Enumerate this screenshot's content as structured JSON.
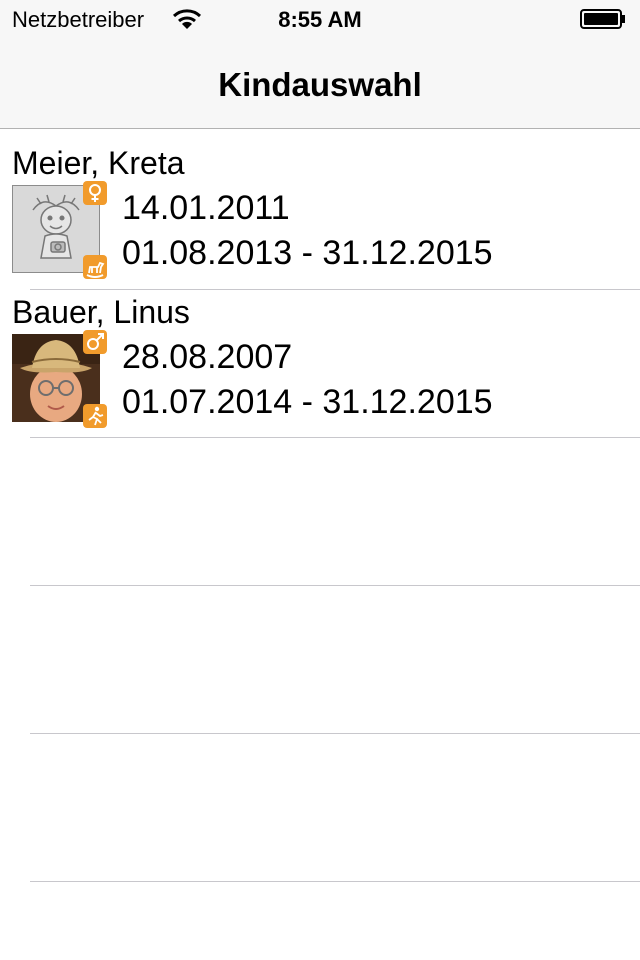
{
  "status": {
    "carrier": "Netzbetreiber",
    "time": "8:55 AM"
  },
  "nav": {
    "title": "Kindauswahl"
  },
  "children": [
    {
      "name": "Meier, Kreta",
      "birthdate": "14.01.2011",
      "period": "01.08.2013 - 31.12.2015",
      "gender_icon": "female-icon",
      "group_icon": "rocking-horse-icon",
      "photo": "placeholder-child-drawing"
    },
    {
      "name": "Bauer, Linus",
      "birthdate": "28.08.2007",
      "period": "01.07.2014 - 31.12.2015",
      "gender_icon": "male-icon",
      "group_icon": "running-child-icon",
      "photo": "boy-with-straw-hat"
    }
  ],
  "colors": {
    "badge": "#f19b2c",
    "separator": "#c8c7cc",
    "bar": "#f7f7f7"
  }
}
